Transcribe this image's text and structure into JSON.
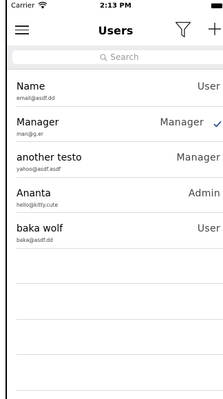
{
  "status_bar": {
    "carrier": "Carrier",
    "time": "2:13 PM"
  },
  "nav": {
    "title": "Users",
    "icons": [
      "menu-icon",
      "filter-icon",
      "add-icon"
    ]
  },
  "search": {
    "placeholder": "Search",
    "value": ""
  },
  "users": [
    {
      "name": "Name",
      "email": "email@asdf.dd",
      "role": "User",
      "checked": false
    },
    {
      "name": "Manager",
      "email": "man@g.er",
      "role": "Manager",
      "checked": true
    },
    {
      "name": "another testo",
      "email": "yahoo@asdf.asdf",
      "role": "Manager",
      "checked": false
    },
    {
      "name": "Ananta",
      "email": "hello@kitty.cute",
      "role": "Admin",
      "checked": false
    },
    {
      "name": "baka wolf",
      "email": "baka@asdf.dd",
      "role": "User",
      "checked": false
    }
  ],
  "colors": {
    "accent": "#1a3d7c",
    "separator": "#dcdcdc",
    "search_bar_bg": "#ececee"
  }
}
